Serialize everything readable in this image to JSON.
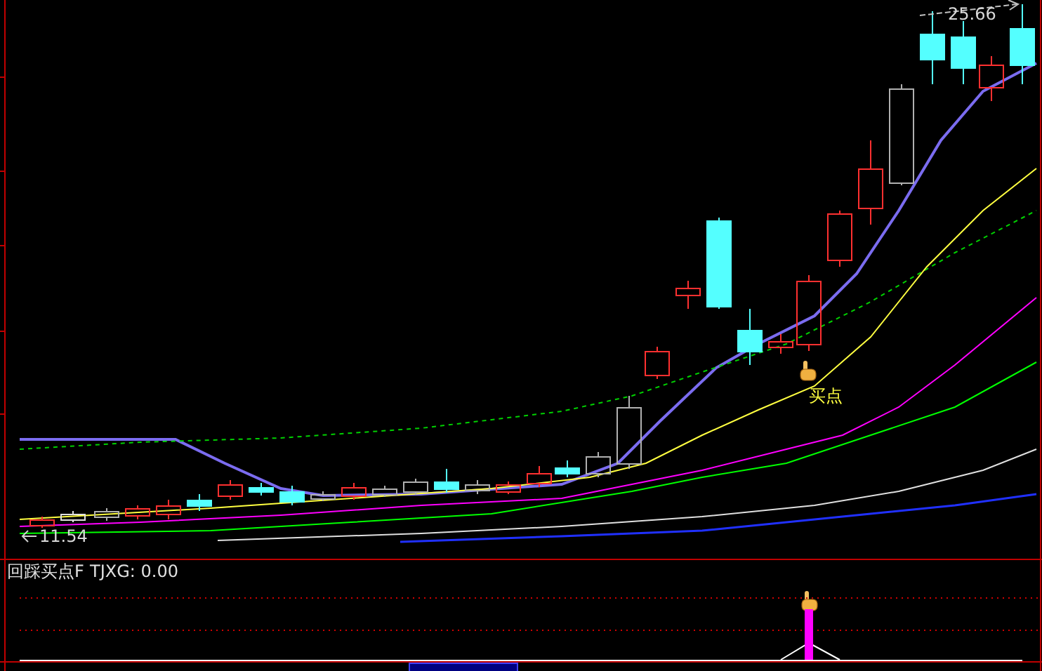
{
  "price_chart": {
    "high_label": "25.66",
    "low_label": "11.54",
    "signal_label": "买点"
  },
  "indicator_panel": {
    "name": "回踩买点F",
    "reading": "TJXG: 0.00"
  }
}
